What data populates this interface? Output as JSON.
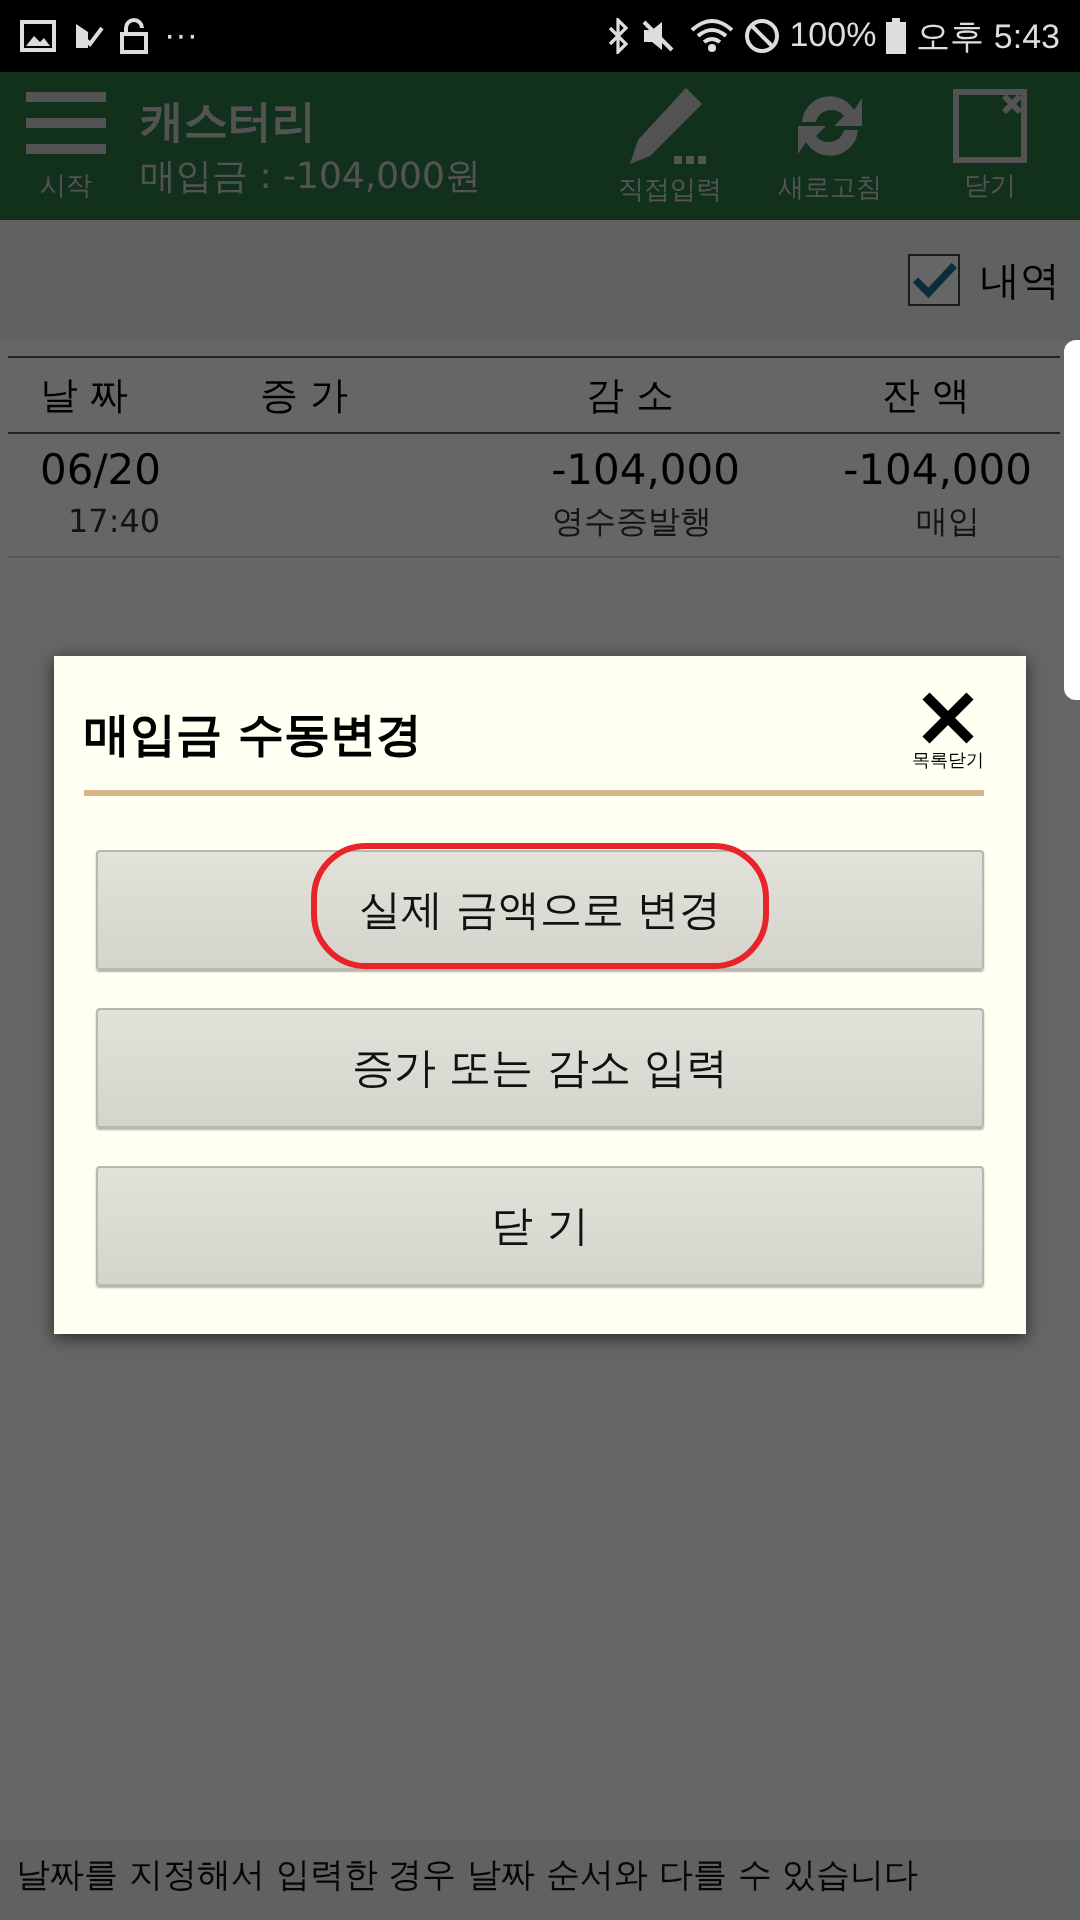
{
  "status_bar": {
    "more": "···",
    "battery": "100%",
    "time": "오후 5:43"
  },
  "app_bar": {
    "menu_label": "시작",
    "title": "캐스터리",
    "subtitle": "매입금 : -104,000원",
    "actions": [
      {
        "kind": "pencil",
        "label": "직접입력"
      },
      {
        "kind": "refresh",
        "label": "새로고침"
      },
      {
        "kind": "close",
        "label": "닫기"
      }
    ]
  },
  "detail_toggle": {
    "label": "내역",
    "checked": true
  },
  "table": {
    "columns": [
      "날 짜",
      "증 가",
      "감 소",
      "잔 액"
    ],
    "rows": [
      {
        "date": "06/20",
        "time": "17:40",
        "increase": "",
        "decrease": "-104,000",
        "decrease_note": "영수증발행",
        "balance": "-104,000",
        "balance_note": "매입"
      }
    ]
  },
  "footer": "날짜를 지정해서 입력한 경우 날짜 순서와 다를 수 있습니다",
  "dialog": {
    "title": "매입금 수동변경",
    "close_label": "목록닫기",
    "buttons": [
      {
        "label": "실제 금액으로 변경",
        "circled": true
      },
      {
        "label": "증가 또는 감소 입력",
        "circled": false
      },
      {
        "label": "닫 기",
        "circled": false
      }
    ]
  }
}
